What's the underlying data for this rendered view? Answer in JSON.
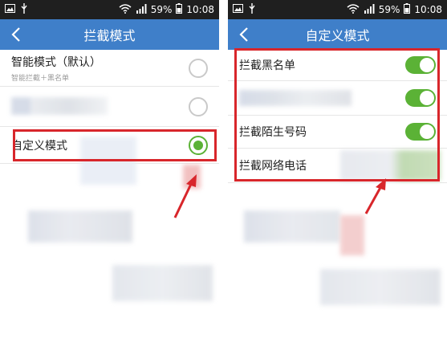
{
  "left": {
    "status": {
      "battery": "59%",
      "time": "10:08"
    },
    "appbar": {
      "title": "拦截模式",
      "back_icon": "chevron-left-icon"
    },
    "options": [
      {
        "label": "智能模式（默认）",
        "sub": "智能拦截＋黑名单",
        "selected": false
      },
      {
        "label": "",
        "sub": "",
        "selected": false
      },
      {
        "label": "自定义模式",
        "sub": "",
        "selected": true
      }
    ]
  },
  "right": {
    "status": {
      "battery": "59%",
      "time": "10:08"
    },
    "appbar": {
      "title": "自定义模式",
      "back_icon": "chevron-left-icon"
    },
    "switches": [
      {
        "label": "拦截黑名单",
        "on": true
      },
      {
        "label": "",
        "on": true
      },
      {
        "label": "拦截陌生号码",
        "on": true
      },
      {
        "label": "拦截网络电话",
        "on": true
      }
    ]
  },
  "colors": {
    "appbar": "#3f7fc9",
    "status": "#1f1f1f",
    "accent": "#5bb236",
    "annotation": "#d8262b"
  }
}
